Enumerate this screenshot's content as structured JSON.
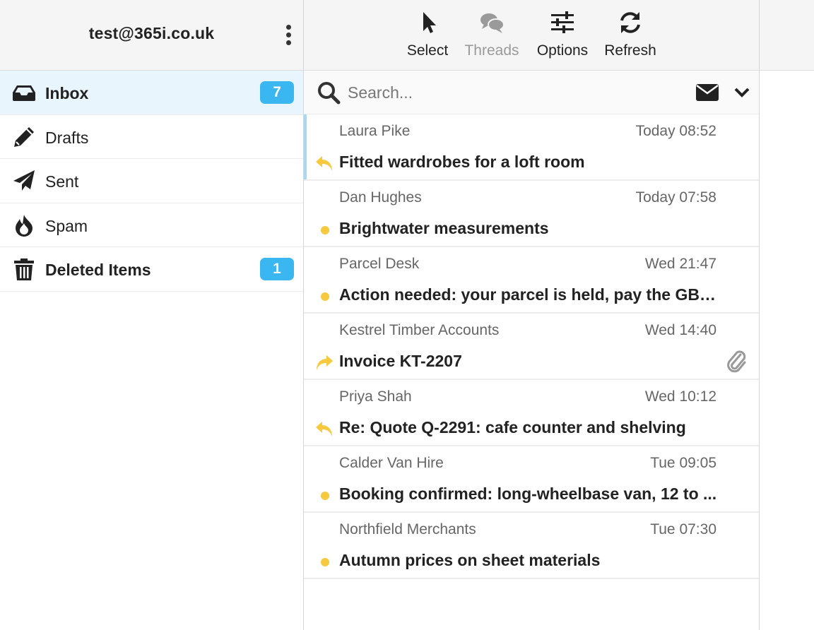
{
  "account": {
    "email": "test@365i.co.uk",
    "menu_icon": "kebab-menu-icon"
  },
  "toolbar": [
    {
      "label": "Select",
      "icon": "cursor-icon",
      "enabled": true
    },
    {
      "label": "Threads",
      "icon": "chat-bubbles-icon",
      "enabled": false
    },
    {
      "label": "Options",
      "icon": "sliders-icon",
      "enabled": true
    },
    {
      "label": "Refresh",
      "icon": "refresh-icon",
      "enabled": true
    }
  ],
  "folders": [
    {
      "name": "Inbox",
      "icon": "inbox-icon",
      "count": "7",
      "active": true
    },
    {
      "name": "Drafts",
      "icon": "pencil-icon",
      "count": ""
    },
    {
      "name": "Sent",
      "icon": "paper-plane-icon",
      "count": ""
    },
    {
      "name": "Spam",
      "icon": "fire-icon",
      "count": ""
    },
    {
      "name": "Deleted Items",
      "icon": "trash-icon",
      "count": "1"
    }
  ],
  "search": {
    "placeholder": "Search...",
    "value": ""
  },
  "colors": {
    "accent": "#3ab6f1",
    "unread_dot": "#f7c93e",
    "active_folder_bg": "#e8f5fd",
    "selected_marker": "#a9d8f5"
  },
  "messages": [
    {
      "sender": "Laura Pike",
      "time": "Today 08:52",
      "subject": "Fitted wardrobes for a loft room",
      "status": "replied",
      "attachment": false
    },
    {
      "sender": "Dan Hughes",
      "time": "Today 07:58",
      "subject": "Brightwater measurements",
      "status": "unread",
      "attachment": false
    },
    {
      "sender": "Parcel Desk",
      "time": "Wed 21:47",
      "subject": "Action needed: your parcel is held, pay the GBP...",
      "status": "unread",
      "attachment": false
    },
    {
      "sender": "Kestrel Timber Accounts",
      "time": "Wed 14:40",
      "subject": "Invoice KT-2207",
      "status": "forwarded",
      "attachment": true
    },
    {
      "sender": "Priya Shah",
      "time": "Wed 10:12",
      "subject": "Re: Quote Q-2291: cafe counter and shelving",
      "status": "replied",
      "attachment": false
    },
    {
      "sender": "Calder Van Hire",
      "time": "Tue 09:05",
      "subject": "Booking confirmed: long-wheelbase van, 12 to ...",
      "status": "unread",
      "attachment": false
    },
    {
      "sender": "Northfield Merchants",
      "time": "Tue 07:30",
      "subject": "Autumn prices on sheet materials",
      "status": "unread",
      "attachment": false
    }
  ]
}
